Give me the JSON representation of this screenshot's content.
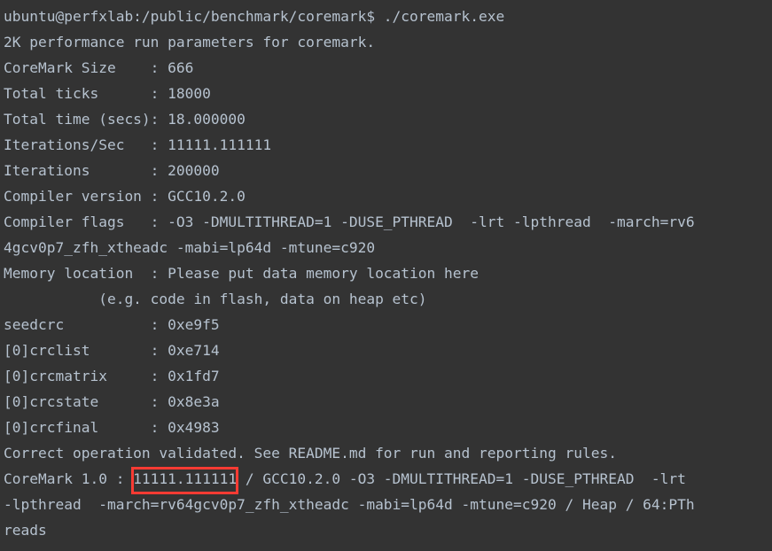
{
  "terminal": {
    "background_color": "#333333",
    "text_color": "#b6c2cf",
    "highlight_color": "#f93b33",
    "prompt": "ubuntu@perfxlab:/public/benchmark/coremark$",
    "command": "./coremark.exe",
    "lines": [
      "ubuntu@perfxlab:/public/benchmark/coremark$ ./coremark.exe",
      "2K performance run parameters for coremark.",
      "CoreMark Size    : 666",
      "Total ticks      : 18000",
      "Total time (secs): 18.000000",
      "Iterations/Sec   : 11111.111111",
      "Iterations       : 200000",
      "Compiler version : GCC10.2.0",
      "Compiler flags   : -O3 -DMULTITHREAD=1 -DUSE_PTHREAD  -lrt -lpthread  -march=rv6",
      "4gcv0p7_zfh_xtheadc -mabi=lp64d -mtune=c920",
      "Memory location  : Please put data memory location here",
      "           (e.g. code in flash, data on heap etc)",
      "seedcrc          : 0xe9f5",
      "[0]crclist       : 0xe714",
      "[0]crcmatrix     : 0x1fd7",
      "[0]crcstate      : 0x8e3a",
      "[0]crcfinal      : 0x4983",
      "Correct operation validated. See README.md for run and reporting rules.",
      "CoreMark 1.0 : 11111.111111 / GCC10.2.0 -O3 -DMULTITHREAD=1 -DUSE_PTHREAD  -lrt",
      "-lpthread  -march=rv64gcv0p7_zfh_xtheadc -mabi=lp64d -mtune=c920 / Heap / 64:PTh",
      "reads"
    ],
    "benchmark": {
      "title": "2K performance run parameters for coremark.",
      "coremark_size_label": "CoreMark Size",
      "coremark_size_value": "666",
      "total_ticks_label": "Total ticks",
      "total_ticks_value": "18000",
      "total_time_label": "Total time (secs)",
      "total_time_value": "18.000000",
      "iterations_per_sec_label": "Iterations/Sec",
      "iterations_per_sec_value": "11111.111111",
      "iterations_label": "Iterations",
      "iterations_value": "200000",
      "compiler_version_label": "Compiler version",
      "compiler_version_value": "GCC10.2.0",
      "compiler_flags_label": "Compiler flags",
      "compiler_flags_value": "-O3 -DMULTITHREAD=1 -DUSE_PTHREAD  -lrt -lpthread  -march=rv64gcv0p7_zfh_xtheadc -mabi=lp64d -mtune=c920",
      "memory_location_label": "Memory location",
      "memory_location_value": "Please put data memory location here",
      "memory_location_note": "(e.g. code in flash, data on heap etc)",
      "seedcrc_label": "seedcrc",
      "seedcrc_value": "0xe9f5",
      "crclist_label": "[0]crclist",
      "crclist_value": "0xe714",
      "crcmatrix_label": "[0]crcmatrix",
      "crcmatrix_value": "0x1fd7",
      "crcstate_label": "[0]crcstate",
      "crcstate_value": "0x8e3a",
      "crcfinal_label": "[0]crcfinal",
      "crcfinal_value": "0x4983",
      "validation_message": "Correct operation validated. See README.md for run and reporting rules.",
      "result_label": "CoreMark 1.0 :",
      "result_score": "11111.111111",
      "result_suffix": "/ GCC10.2.0 -O3 -DMULTITHREAD=1 -DUSE_PTHREAD  -lrt -lpthread  -march=rv64gcv0p7_zfh_xtheadc -mabi=lp64d -mtune=c920 / Heap / 64:PThreads"
    }
  }
}
